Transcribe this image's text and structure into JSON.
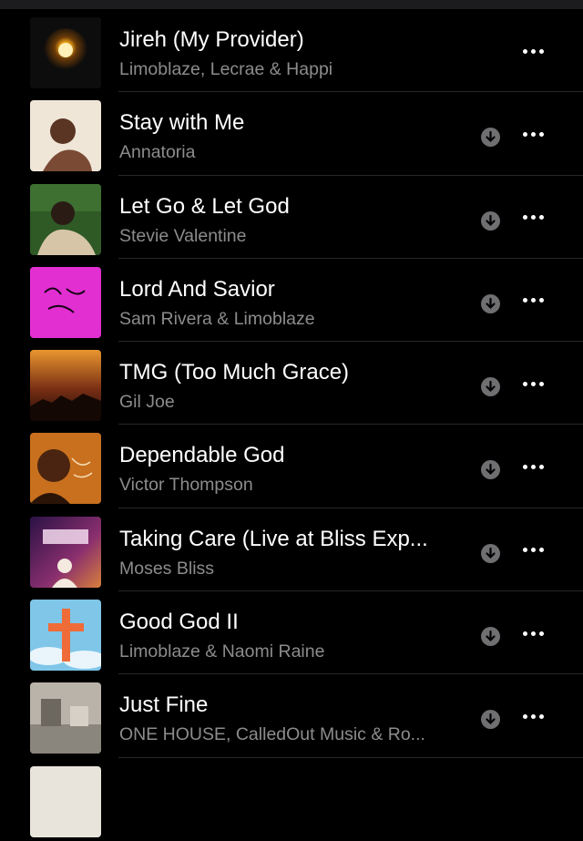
{
  "songs": [
    {
      "title": "Jireh (My Provider)",
      "artist": "Limoblaze, Lecrae & Happi",
      "downloaded": true
    },
    {
      "title": "Stay with Me",
      "artist": "Annatoria",
      "downloaded": false
    },
    {
      "title": "Let Go & Let God",
      "artist": "Stevie Valentine",
      "downloaded": false
    },
    {
      "title": "Lord And Savior",
      "artist": "Sam Rivera & Limoblaze",
      "downloaded": false
    },
    {
      "title": "TMG (Too Much Grace)",
      "artist": "Gil Joe",
      "downloaded": false
    },
    {
      "title": "Dependable God",
      "artist": "Victor Thompson",
      "downloaded": false
    },
    {
      "title": "Taking Care (Live at Bliss Exp...",
      "artist": "Moses Bliss",
      "downloaded": false
    },
    {
      "title": "Good God II",
      "artist": "Limoblaze & Naomi Raine",
      "downloaded": false
    },
    {
      "title": "Just Fine",
      "artist": "ONE HOUSE, CalledOut Music & Ro...",
      "downloaded": false
    }
  ],
  "colors": {
    "background": "#000000",
    "title": "#ffffff",
    "subtitle": "#8c8c8c",
    "download_badge": "#6f6f72"
  },
  "icons": {
    "download": "arrow-down-circle-icon",
    "more": "ellipsis-icon"
  }
}
